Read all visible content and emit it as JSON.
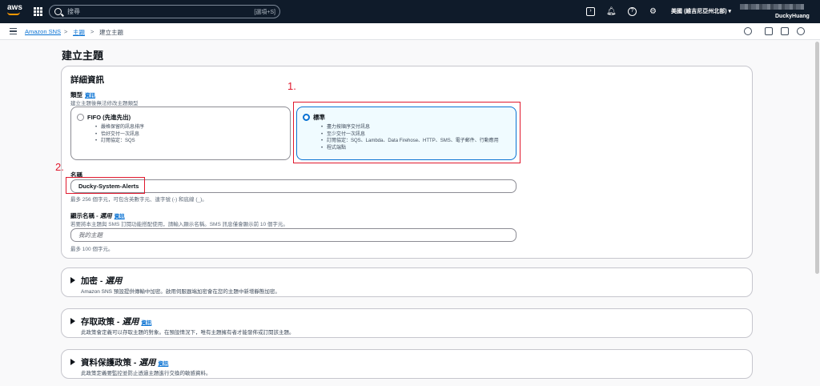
{
  "topbar": {
    "logo_text": "aws",
    "search_placeholder": "搜尋",
    "search_shortcut": "[選項+S]",
    "region": "美國 (維吉尼亞州北部) ▾",
    "account": "DuckyHuang"
  },
  "breadcrumb": {
    "items": [
      "Amazon SNS",
      "主題",
      "建立主題"
    ],
    "separator": ">"
  },
  "page": {
    "title": "建立主題"
  },
  "details": {
    "title": "詳細資訊",
    "type_label": "類型",
    "info": "資訊",
    "type_desc": "建立主題後無法修改主題類型",
    "fifo": {
      "title": "FIFO (先進先出)",
      "bullets": [
        "嚴格保留的訊息排序",
        "恰好交付一次訊息",
        "訂閱協定：SQS"
      ]
    },
    "standard": {
      "title": "標準",
      "bullets": [
        "盡力按順序交付訊息",
        "至少交付一次訊息",
        "訂閱協定：SQS、Lambda、Data Firehose、HTTP、SMS、電子郵件、行動應用",
        "程式端點"
      ]
    },
    "name_label": "名稱",
    "name_value": "Ducky-System-Alerts",
    "name_hint": "最多 256 個字元，可包含英數字元、連字號 (-) 和底線 (_)。",
    "display_label": "顯示名稱 - ",
    "display_optional": "選用",
    "display_desc": "若要將本主題與 SMS 訂閱功能搭配使用，請輸入顯示名稱。SMS 訊息僅會顯示前 10 個字元。",
    "display_placeholder": "我的主題",
    "display_hint": "最多 100 個字元。"
  },
  "annotations": [
    "1.",
    "2."
  ],
  "sections": [
    {
      "title": "加密 - ",
      "optional": "選用",
      "info": "",
      "desc": "Amazon SNS 預設提供傳輸中加密。啟用伺服器端加密會在您的主題中新增靜態加密。"
    },
    {
      "title": "存取政策 - ",
      "optional": "選用",
      "info": "資訊",
      "desc": "此政策會定義可以存取主題的對象。在預設情況下，唯有主題擁有者才能發佈或訂閱該主題。"
    },
    {
      "title": "資料保護政策 - ",
      "optional": "選用",
      "info": "資訊",
      "desc": "此政策定義要監控並防止透過主題進行交換的敏感資料。"
    }
  ]
}
